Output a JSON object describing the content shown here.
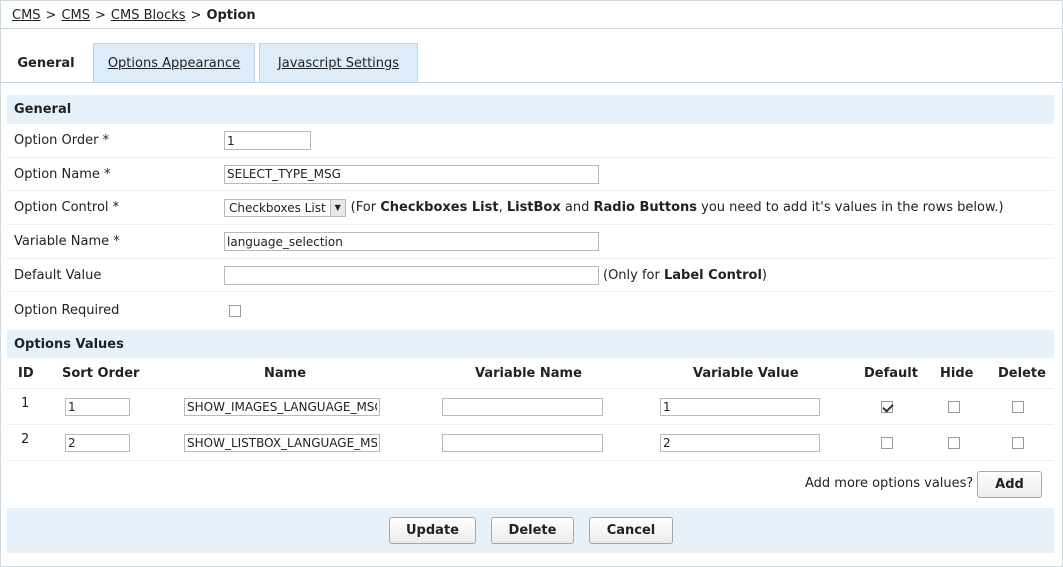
{
  "breadcrumb": {
    "items": [
      "CMS",
      "CMS",
      "CMS Blocks"
    ],
    "separator": ">",
    "current": "Option"
  },
  "tabs": [
    "General",
    "Options Appearance",
    "Javascript Settings"
  ],
  "general": {
    "heading": "General",
    "fields": {
      "option_order": {
        "label": "Option Order *",
        "value": "1"
      },
      "option_name": {
        "label": "Option Name *",
        "value": "SELECT_TYPE_MSG"
      },
      "option_control": {
        "label": "Option Control *",
        "selected": "Checkboxes List",
        "hint_pre": "(For ",
        "hint_b1": "Checkboxes List",
        "hint_c1": ", ",
        "hint_b2": "ListBox",
        "hint_c2": " and ",
        "hint_b3": "Radio Buttons",
        "hint_post": " you need to add it's values in the rows below.)"
      },
      "variable_name": {
        "label": "Variable Name *",
        "value": "language_selection"
      },
      "default_value": {
        "label": "Default Value",
        "value": "",
        "hint_pre": "(Only for ",
        "hint_b": "Label Control",
        "hint_post": ")"
      },
      "option_required": {
        "label": "Option Required",
        "checked": false
      }
    }
  },
  "options_values": {
    "heading": "Options Values",
    "columns": [
      "ID",
      "Sort Order",
      "Name",
      "Variable Name",
      "Variable Value",
      "Default",
      "Hide",
      "Delete"
    ],
    "rows": [
      {
        "id": "1",
        "sort_order": "1",
        "name": "SHOW_IMAGES_LANGUAGE_MSG",
        "variable_name": "",
        "variable_value": "1",
        "default": true,
        "hide": false,
        "delete": false
      },
      {
        "id": "2",
        "sort_order": "2",
        "name": "SHOW_LISTBOX_LANGUAGE_MSG",
        "variable_name": "",
        "variable_value": "2",
        "default": false,
        "hide": false,
        "delete": false
      }
    ],
    "add_prompt": "Add more options values?",
    "add_label": "Add"
  },
  "actions": {
    "update": "Update",
    "delete": "Delete",
    "cancel": "Cancel"
  }
}
